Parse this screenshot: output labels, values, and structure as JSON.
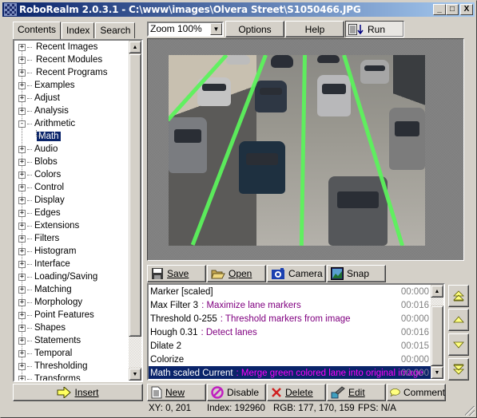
{
  "window": {
    "title": "RoboRealm 2.0.3.1 - C:\\www\\images\\Olvera Street\\S1050466.JPG",
    "controls": {
      "minimize": "_",
      "maximize": "□",
      "close": "X"
    }
  },
  "left_tabs": [
    {
      "label": "Contents",
      "active": true
    },
    {
      "label": "Index",
      "active": false
    },
    {
      "label": "Search",
      "active": false
    }
  ],
  "tree": {
    "items": [
      {
        "label": "Recent Images",
        "state": "+"
      },
      {
        "label": "Recent Modules",
        "state": "+"
      },
      {
        "label": "Recent Programs",
        "state": "+"
      },
      {
        "label": "Examples",
        "state": "+"
      },
      {
        "label": "Adjust",
        "state": "+"
      },
      {
        "label": "Analysis",
        "state": "+"
      },
      {
        "label": "Arithmetic",
        "state": "-"
      },
      {
        "label": "Math",
        "child": true,
        "selected": true
      },
      {
        "label": "Audio",
        "state": "+"
      },
      {
        "label": "Blobs",
        "state": "+"
      },
      {
        "label": "Colors",
        "state": "+"
      },
      {
        "label": "Control",
        "state": "+"
      },
      {
        "label": "Display",
        "state": "+"
      },
      {
        "label": "Edges",
        "state": "+"
      },
      {
        "label": "Extensions",
        "state": "+"
      },
      {
        "label": "Filters",
        "state": "+"
      },
      {
        "label": "Histogram",
        "state": "+"
      },
      {
        "label": "Interface",
        "state": "+"
      },
      {
        "label": "Loading/Saving",
        "state": "+"
      },
      {
        "label": "Matching",
        "state": "+"
      },
      {
        "label": "Morphology",
        "state": "+"
      },
      {
        "label": "Point Features",
        "state": "+"
      },
      {
        "label": "Shapes",
        "state": "+"
      },
      {
        "label": "Statements",
        "state": "+"
      },
      {
        "label": "Temporal",
        "state": "+"
      },
      {
        "label": "Thresholding",
        "state": "+"
      },
      {
        "label": "Transforms",
        "state": "+"
      }
    ]
  },
  "insert_button": {
    "label": "Insert",
    "icon": "arrow-right-icon"
  },
  "toolbar": {
    "zoom_value": "Zoom 100%",
    "options_label": "Options",
    "help_label": "Help",
    "run_label": "Run"
  },
  "image_toolbar": {
    "save_label": "Save",
    "open_label": "Open",
    "camera_label": "Camera",
    "snap_label": "Snap"
  },
  "pipeline": {
    "rows": [
      {
        "module": "Marker [scaled]",
        "comment": "",
        "time": "00:000"
      },
      {
        "module": "Max Filter 3",
        "comment": ": Maximize lane markers",
        "time": "00:016"
      },
      {
        "module": "Threshold 0-255",
        "comment": ": Threshold markers from image",
        "time": "00:000"
      },
      {
        "module": "Hough 0.31",
        "comment": ": Detect lanes",
        "time": "00:016"
      },
      {
        "module": "Dilate 2",
        "comment": "",
        "time": "00:015"
      },
      {
        "module": "Colorize",
        "comment": "",
        "time": "00:000"
      },
      {
        "module": "Math scaled Current",
        "comment": ": Merge green colored lane into original image",
        "time": "00:000",
        "selected": true
      }
    ]
  },
  "pipeline_buttons": {
    "new_label": "New",
    "disable_label": "Disable",
    "delete_label": "Delete",
    "edit_label": "Edit",
    "comment_label": "Comment"
  },
  "status": {
    "xy": "XY: 0, 201",
    "index": "Index: 192960",
    "rgb": "RGB: 177, 170, 159",
    "fps": "FPS: N/A"
  },
  "colors": {
    "title_start": "#0a246a",
    "title_end": "#a6caf0",
    "selection": "#0a246a",
    "comment": "#800080",
    "comment_selected": "#ff00ff",
    "lane_marker": "#5cf25c"
  }
}
